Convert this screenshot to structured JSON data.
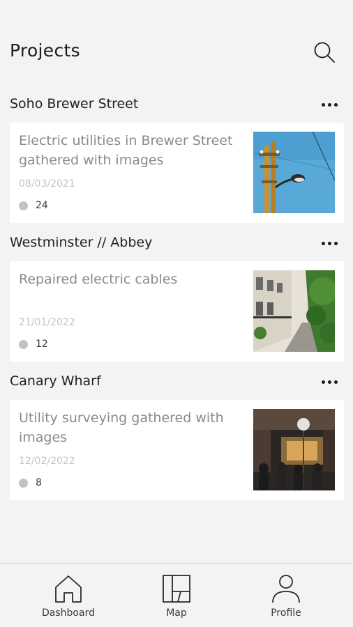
{
  "header": {
    "title": "Projects",
    "search_icon": "search-icon"
  },
  "projects": [
    {
      "name": "Soho Brewer Street",
      "description": "Electric utilities in Brewer Street gathered with images",
      "date": "08/03/2021",
      "count": "24",
      "thumbnail": "street-lamp-photo"
    },
    {
      "name": "Westminster // Abbey",
      "description": "Repaired electric cables",
      "date": "21/01/2022",
      "count": "12",
      "thumbnail": "residential-street-photo"
    },
    {
      "name": "Canary Wharf",
      "description": "Utility surveying gathered with images",
      "date": "12/02/2022",
      "count": "8",
      "thumbnail": "station-crowd-photo"
    }
  ],
  "nav": {
    "dashboard_label": "Dashboard",
    "map_label": "Map",
    "profile_label": "Profile"
  },
  "colors": {
    "background": "#f3f3f3",
    "card": "#ffffff",
    "text_muted": "#8a8a8a",
    "date": "#c3c3c3"
  }
}
